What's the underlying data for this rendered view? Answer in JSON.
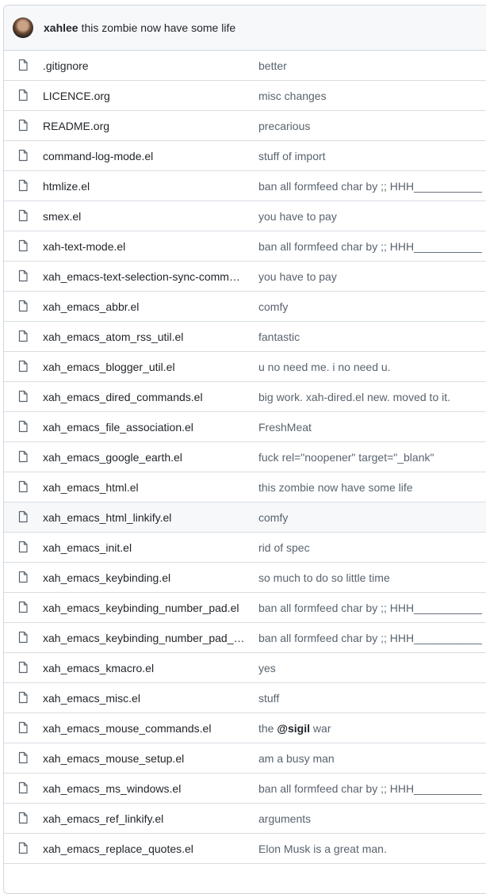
{
  "latest_commit": {
    "author": "xahlee",
    "message": "this zombie now have some life"
  },
  "files": [
    {
      "name": ".gitignore",
      "message": "better"
    },
    {
      "name": "LICENCE.org",
      "message": "misc changes"
    },
    {
      "name": "README.org",
      "message": "precarious"
    },
    {
      "name": "command-log-mode.el",
      "message": "stuff of import"
    },
    {
      "name": "htmlize.el",
      "message": "ban all formfeed char by ;; HHH___________"
    },
    {
      "name": "smex.el",
      "message": "you have to pay"
    },
    {
      "name": "xah-text-mode.el",
      "message": "ban all formfeed char by ;; HHH___________"
    },
    {
      "name": "xah_emacs-text-selection-sync-comm…",
      "message": "you have to pay"
    },
    {
      "name": "xah_emacs_abbr.el",
      "message": "comfy"
    },
    {
      "name": "xah_emacs_atom_rss_util.el",
      "message": "fantastic"
    },
    {
      "name": "xah_emacs_blogger_util.el",
      "message": "u no need me. i no need u."
    },
    {
      "name": "xah_emacs_dired_commands.el",
      "message": "big work. xah-dired.el new. moved to it."
    },
    {
      "name": "xah_emacs_file_association.el",
      "message": "FreshMeat"
    },
    {
      "name": "xah_emacs_google_earth.el",
      "message": "fuck rel=\"noopener\" target=\"_blank\""
    },
    {
      "name": "xah_emacs_html.el",
      "message": "this zombie now have some life"
    },
    {
      "name": "xah_emacs_html_linkify.el",
      "message": "comfy"
    },
    {
      "name": "xah_emacs_init.el",
      "message": "rid of spec"
    },
    {
      "name": "xah_emacs_keybinding.el",
      "message": "so much to do so little time"
    },
    {
      "name": "xah_emacs_keybinding_number_pad.el",
      "message": "ban all formfeed char by ;; HHH___________"
    },
    {
      "name": "xah_emacs_keybinding_number_pad_…",
      "message": "ban all formfeed char by ;; HHH___________"
    },
    {
      "name": "xah_emacs_kmacro.el",
      "message": "yes"
    },
    {
      "name": "xah_emacs_misc.el",
      "message": "stuff"
    },
    {
      "name": "xah_emacs_mouse_commands.el",
      "message_parts": [
        "the ",
        "@sigil",
        " war"
      ]
    },
    {
      "name": "xah_emacs_mouse_setup.el",
      "message": "am a busy man"
    },
    {
      "name": "xah_emacs_ms_windows.el",
      "message": "ban all formfeed char by ;; HHH___________"
    },
    {
      "name": "xah_emacs_ref_linkify.el",
      "message": "arguments"
    },
    {
      "name": "xah_emacs_replace_quotes.el",
      "message": "Elon Musk is a great man."
    }
  ],
  "hover_row_index": 15,
  "icons": {
    "avatar": "user-avatar",
    "file": "file-icon"
  }
}
